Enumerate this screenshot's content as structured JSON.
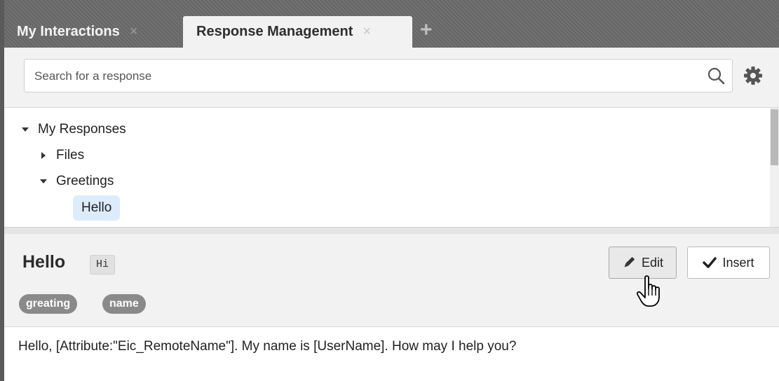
{
  "tabs": [
    {
      "label": "My Interactions",
      "active": false
    },
    {
      "label": "Response Management",
      "active": true
    }
  ],
  "tab_close_glyph": "×",
  "add_tab_glyph": "+",
  "search": {
    "placeholder": "Search for a response",
    "value": ""
  },
  "icons": {
    "search": "search-icon",
    "settings": "gear-icon",
    "cursor": "hand-pointer-icon"
  },
  "tree": {
    "root_label": "My Responses",
    "folders": [
      {
        "label": "Files",
        "expanded": false
      },
      {
        "label": "Greetings",
        "expanded": true
      }
    ],
    "selected_item": "Hello"
  },
  "detail": {
    "title": "Hello",
    "shortcut": "Hi",
    "tags": [
      "greating",
      "name"
    ],
    "edit_label": "Edit",
    "insert_label": "Insert",
    "body": "Hello, [Attribute:\"Eic_RemoteName\"]. My name is [UserName]. How may I help you?"
  },
  "colors": {
    "tabbar": "#6b6b6b",
    "panel": "#f2f2f2",
    "selection": "#dcecfb",
    "tag": "#8a8a8a"
  }
}
